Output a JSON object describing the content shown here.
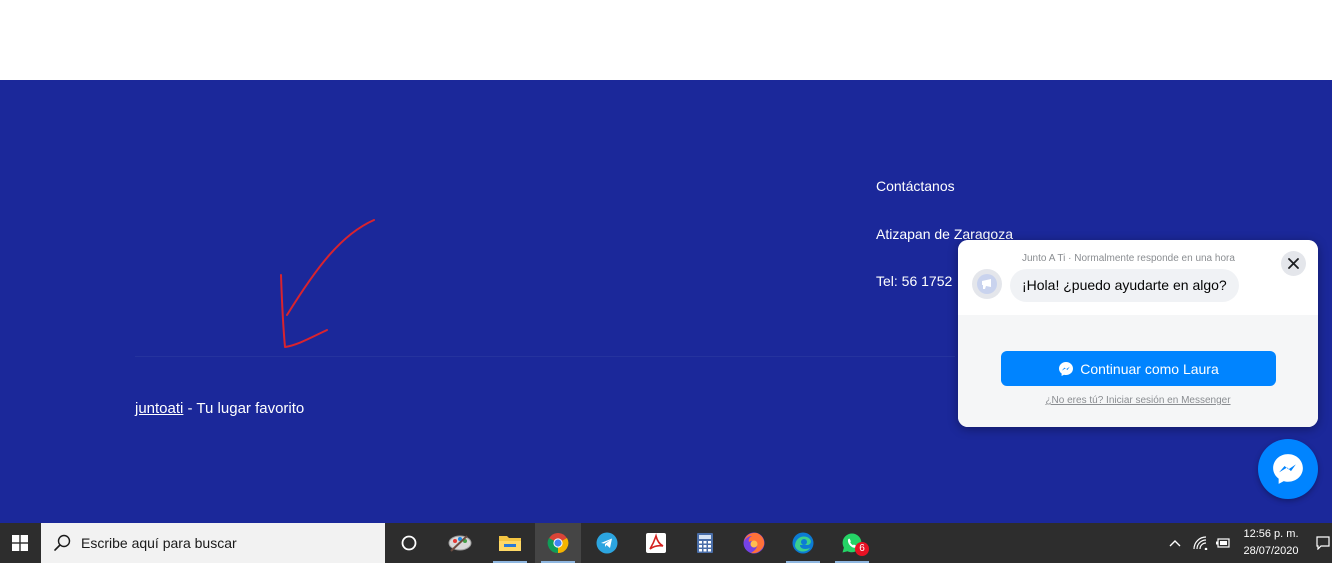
{
  "footer": {
    "contact_title": "Contáctanos",
    "contact_city": "Atizapan de Zaragoza",
    "contact_phone": "Tel: 56 1752 ",
    "credit_link": "juntoati",
    "credit_text": " - Tu lugar favorito"
  },
  "chat": {
    "page_name": "Junto A Ti",
    "response_note": " · Normalmente responde en una hora",
    "greeting": "¡Hola! ¿puedo ayudarte en algo?",
    "continue_label": "Continuar como Laura",
    "alt_login": "¿No eres tú? Iniciar sesión en Messenger"
  },
  "taskbar": {
    "search_placeholder": "Escribe aquí para buscar",
    "time": "12:56 p. m.",
    "date": "28/07/2020",
    "whatsapp_badge": "6",
    "apps": [
      "cortana-icon",
      "paint-icon",
      "file-explorer-icon",
      "chrome-icon",
      "telegram-icon",
      "acrobat-icon",
      "calculator-icon",
      "firefox-icon",
      "edge-icon",
      "whatsapp-icon"
    ]
  },
  "colors": {
    "footer_bg": "#1b289a",
    "messenger_blue": "#0084ff",
    "taskbar_bg": "#2d2d2d",
    "annotation_red": "#d9232e"
  }
}
